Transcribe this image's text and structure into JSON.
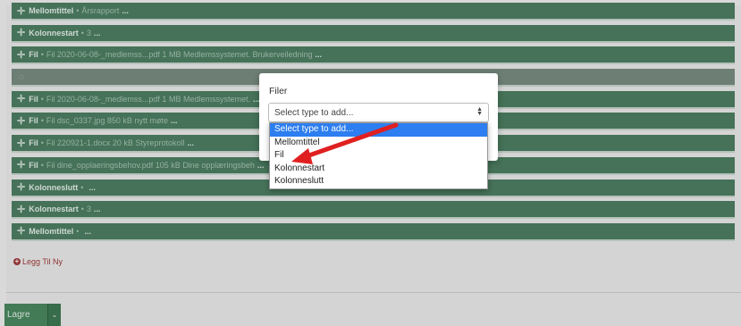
{
  "rows": [
    {
      "type": "Mellomtittel",
      "desc": "Årsrapport",
      "empty": false
    },
    {
      "type": "Kolonnestart",
      "desc": "3",
      "empty": false
    },
    {
      "type": "Fil",
      "desc": "Fil 2020-06-08-_medlemss...pdf 1 MB Medlemssystemet. Brukerveiledning",
      "empty": false
    },
    {
      "type": "",
      "desc": "",
      "empty": true
    },
    {
      "type": "Fil",
      "desc": "Fil 2020-06-08-_medlemss...pdf 1 MB Medlemssystemet.",
      "empty": false
    },
    {
      "type": "Fil",
      "desc": "Fil dsc_0337.jpg 850 kB nytt møte",
      "empty": false
    },
    {
      "type": "Fil",
      "desc": "Fil 220921-1.docx 20 kB Styreprotokoll",
      "empty": false
    },
    {
      "type": "Fil",
      "desc": "Fil dine_opplaeringsbehov.pdf 105 kB Dine opplæringsbeh",
      "empty": false
    },
    {
      "type": "Kolonneslutt",
      "desc": "",
      "empty": false
    },
    {
      "type": "Kolonnestart",
      "desc": "3",
      "empty": false
    },
    {
      "type": "Mellomtittel",
      "desc": "",
      "empty": false
    }
  ],
  "row_separator": "•",
  "row_ellipsis": "...",
  "add_new_label": "Legg Til Ny",
  "save_label": "Lagre",
  "dialog": {
    "title": "Filer",
    "select_value": "Select type to add...",
    "options": [
      "Select type to add...",
      "Mellomtittel",
      "Fil",
      "Kolonnestart",
      "Kolonneslutt"
    ],
    "selected_index": 0
  },
  "colors": {
    "row_bg": "#4d7f63",
    "add_new": "#a33a3a",
    "selected_option": "#2d7ef0",
    "arrow": "#e02020"
  },
  "icons": {
    "row_drag": "move-icon",
    "add_new": "plus-circle-icon",
    "select_arrows": "updown-chevron-icon",
    "save_caret": "chevron-down-icon",
    "annotation": "red-arrow-annotation"
  }
}
